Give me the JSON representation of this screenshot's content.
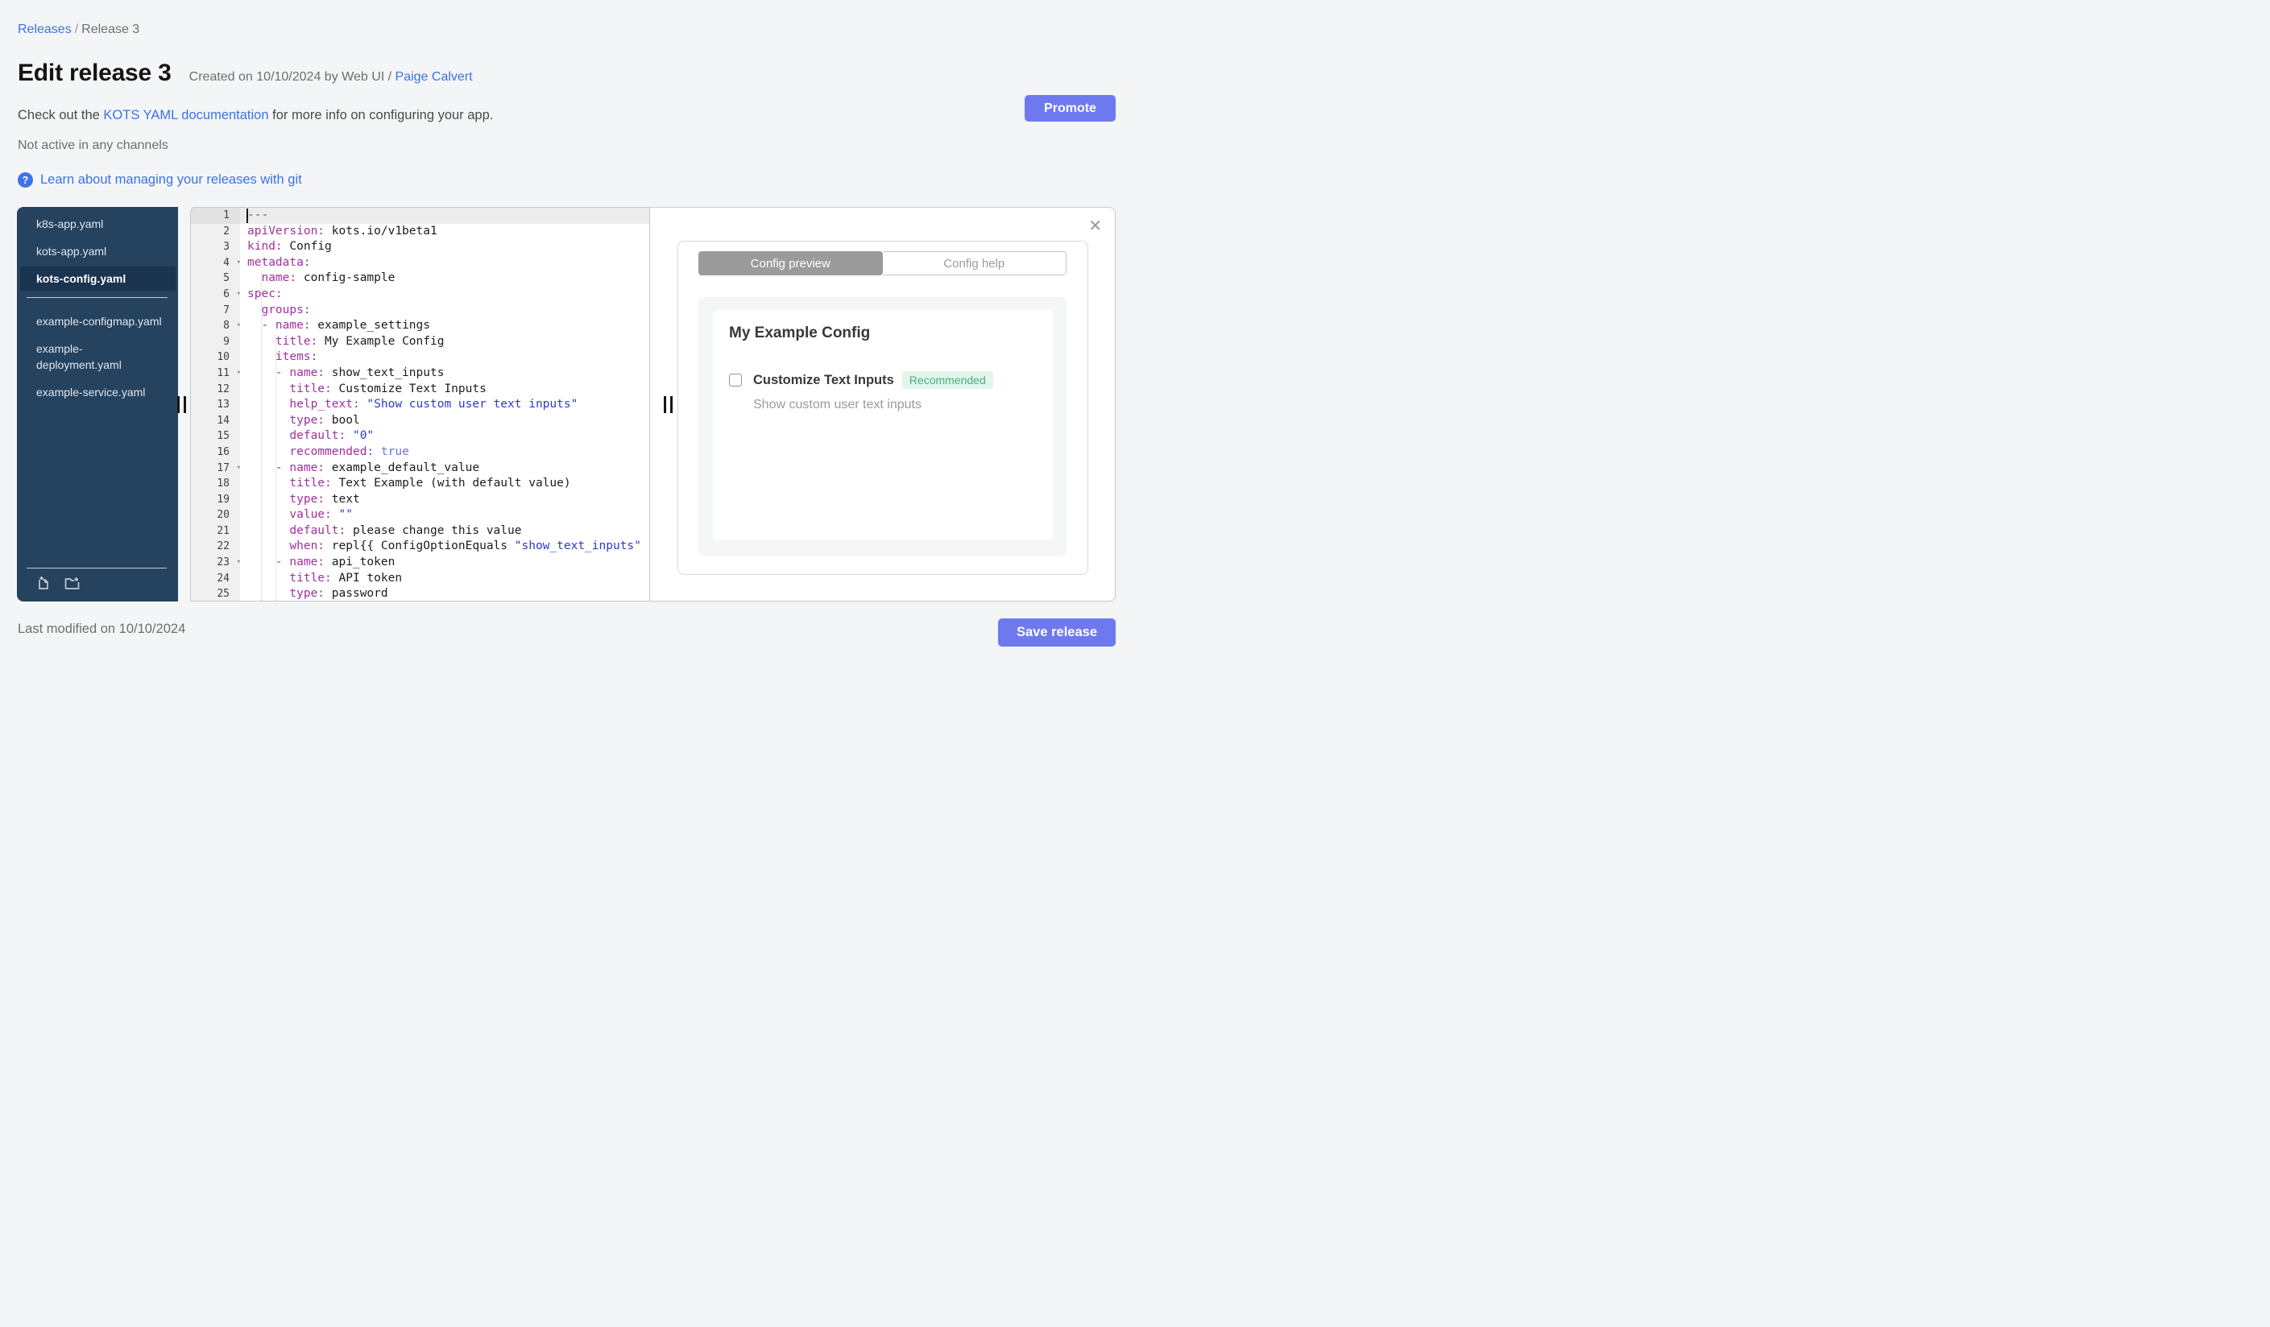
{
  "breadcrumb": {
    "link": "Releases",
    "separator": "/",
    "current": "Release 3"
  },
  "header": {
    "title": "Edit release 3",
    "created_prefix": "Created on 10/10/2024 by Web UI / ",
    "created_author": "Paige Calvert",
    "promote_label": "Promote"
  },
  "info": {
    "docs_prefix": "Check out the ",
    "docs_link": "KOTS YAML documentation",
    "docs_suffix": " for more info on configuring your app.",
    "channel_status": "Not active in any channels",
    "git_link": "Learn about managing your releases with git"
  },
  "icons": {
    "help": "?",
    "close": "✕",
    "fold": "▾",
    "new_file": "file-plus-icon",
    "new_folder": "folder-plus-icon"
  },
  "sidebar": {
    "files": [
      {
        "name": "k8s-app.yaml",
        "selected": false
      },
      {
        "name": "kots-app.yaml",
        "selected": false
      },
      {
        "name": "kots-config.yaml",
        "selected": true
      },
      {
        "name": "example-configmap.yaml",
        "selected": false,
        "divider_before": true
      },
      {
        "name": "example-deployment.yaml",
        "selected": false
      },
      {
        "name": "example-service.yaml",
        "selected": false
      }
    ]
  },
  "editor": {
    "lines": [
      {
        "n": 1,
        "active": true,
        "cursor": true,
        "tokens": [
          [
            "meta",
            "---"
          ]
        ]
      },
      {
        "n": 2,
        "tokens": [
          [
            "key",
            "apiVersion:"
          ],
          [
            "text",
            " kots.io/v1beta1"
          ]
        ]
      },
      {
        "n": 3,
        "tokens": [
          [
            "key",
            "kind:"
          ],
          [
            "text",
            " Config"
          ]
        ]
      },
      {
        "n": 4,
        "fold": true,
        "tokens": [
          [
            "key",
            "metadata:"
          ]
        ]
      },
      {
        "n": 5,
        "tokens": [
          [
            "text",
            "  "
          ],
          [
            "key",
            "name:"
          ],
          [
            "text",
            " config-sample"
          ]
        ]
      },
      {
        "n": 6,
        "fold": true,
        "tokens": [
          [
            "key",
            "spec:"
          ]
        ]
      },
      {
        "n": 7,
        "tokens": [
          [
            "text",
            "  "
          ],
          [
            "key",
            "groups:"
          ]
        ]
      },
      {
        "n": 8,
        "fold": true,
        "tokens": [
          [
            "text",
            "  "
          ],
          [
            "key",
            "- name:"
          ],
          [
            "text",
            " example_settings"
          ]
        ]
      },
      {
        "n": 9,
        "tokens": [
          [
            "text",
            "    "
          ],
          [
            "key",
            "title:"
          ],
          [
            "text",
            " My Example Config"
          ]
        ]
      },
      {
        "n": 10,
        "tokens": [
          [
            "text",
            "    "
          ],
          [
            "key",
            "items:"
          ]
        ]
      },
      {
        "n": 11,
        "fold": true,
        "tokens": [
          [
            "text",
            "    "
          ],
          [
            "key",
            "- name:"
          ],
          [
            "text",
            " show_text_inputs"
          ]
        ]
      },
      {
        "n": 12,
        "tokens": [
          [
            "text",
            "      "
          ],
          [
            "key",
            "title:"
          ],
          [
            "text",
            " Customize Text Inputs"
          ]
        ]
      },
      {
        "n": 13,
        "tokens": [
          [
            "text",
            "      "
          ],
          [
            "key",
            "help_text:"
          ],
          [
            "string",
            " \"Show custom user text inputs\""
          ]
        ]
      },
      {
        "n": 14,
        "tokens": [
          [
            "text",
            "      "
          ],
          [
            "key",
            "type:"
          ],
          [
            "text",
            " bool"
          ]
        ]
      },
      {
        "n": 15,
        "tokens": [
          [
            "text",
            "      "
          ],
          [
            "key",
            "default:"
          ],
          [
            "string",
            " \"0\""
          ]
        ]
      },
      {
        "n": 16,
        "tokens": [
          [
            "text",
            "      "
          ],
          [
            "key",
            "recommended:"
          ],
          [
            "bool",
            " true"
          ]
        ]
      },
      {
        "n": 17,
        "fold": true,
        "tokens": [
          [
            "text",
            "    "
          ],
          [
            "key",
            "- name:"
          ],
          [
            "text",
            " example_default_value"
          ]
        ]
      },
      {
        "n": 18,
        "tokens": [
          [
            "text",
            "      "
          ],
          [
            "key",
            "title:"
          ],
          [
            "text",
            " Text Example (with default value)"
          ]
        ]
      },
      {
        "n": 19,
        "tokens": [
          [
            "text",
            "      "
          ],
          [
            "key",
            "type:"
          ],
          [
            "text",
            " text"
          ]
        ]
      },
      {
        "n": 20,
        "tokens": [
          [
            "text",
            "      "
          ],
          [
            "key",
            "value:"
          ],
          [
            "string",
            " \"\""
          ]
        ]
      },
      {
        "n": 21,
        "tokens": [
          [
            "text",
            "      "
          ],
          [
            "key",
            "default:"
          ],
          [
            "text",
            " please change this value"
          ]
        ]
      },
      {
        "n": 22,
        "tokens": [
          [
            "text",
            "      "
          ],
          [
            "key",
            "when:"
          ],
          [
            "text",
            " repl{{ ConfigOptionEquals "
          ],
          [
            "string",
            "\"show_text_inputs\""
          ]
        ]
      },
      {
        "n": 23,
        "fold": true,
        "tokens": [
          [
            "text",
            "    "
          ],
          [
            "key",
            "- name:"
          ],
          [
            "text",
            " api_token"
          ]
        ]
      },
      {
        "n": 24,
        "tokens": [
          [
            "text",
            "      "
          ],
          [
            "key",
            "title:"
          ],
          [
            "text",
            " API token"
          ]
        ]
      },
      {
        "n": 25,
        "tokens": [
          [
            "text",
            "      "
          ],
          [
            "key",
            "type:"
          ],
          [
            "text",
            " password"
          ]
        ]
      }
    ]
  },
  "preview": {
    "tabs": [
      {
        "label": "Config preview",
        "active": true
      },
      {
        "label": "Config help",
        "active": false
      }
    ],
    "group_title": "My Example Config",
    "item": {
      "label": "Customize Text Inputs",
      "badge": "Recommended",
      "help": "Show custom user text inputs",
      "checked": false
    }
  },
  "footer": {
    "last_modified": "Last modified on 10/10/2024",
    "save_label": "Save release"
  },
  "colors": {
    "accent": "#6f79ef",
    "link": "#3b72e8",
    "sidebar_bg": "#25425f",
    "sidebar_selected_bg": "#1b3450",
    "tab_active_bg": "#9b9b9b",
    "badge_bg": "#e3f6ec",
    "badge_text": "#44b07e",
    "yaml_key": "#a12f9e",
    "yaml_string": "#2c3ac8",
    "yaml_bool": "#6b74dc"
  }
}
